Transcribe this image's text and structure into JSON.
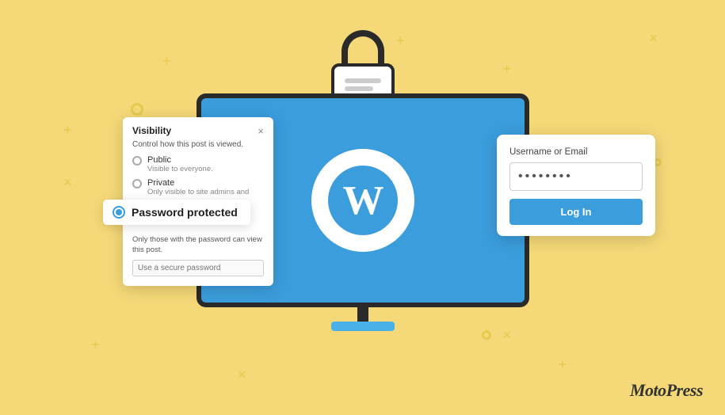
{
  "background_color": "#F5D978",
  "visibility_panel": {
    "title": "Visibility",
    "close_button": "×",
    "subtitle": "Control how this post is viewed.",
    "options": [
      {
        "label": "Public",
        "description": "Visible to everyone."
      },
      {
        "label": "Private",
        "description": "Only visible to site admins and"
      }
    ],
    "selected_option": "Password protected",
    "bottom_description": "Only those with the password can view this post.",
    "password_placeholder": "Use a secure password"
  },
  "login_panel": {
    "username_label": "Username or Email",
    "password_value": "********",
    "login_button": "Log In"
  },
  "branding": {
    "name": "MotoPress"
  },
  "decorative": {
    "plus_symbols": [
      "+",
      "+",
      "+",
      "+",
      "+",
      "+"
    ],
    "x_symbols": [
      "×",
      "×",
      "×",
      "×"
    ]
  }
}
